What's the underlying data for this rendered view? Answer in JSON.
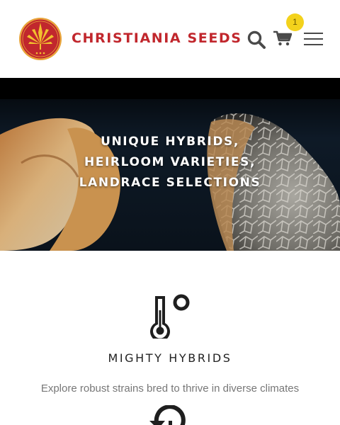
{
  "header": {
    "brand": "CHRISTIANIA SEEDS",
    "cart_count": "1",
    "logo_icon": "cannabis-leaf-icon",
    "icons": [
      "search-icon",
      "cart-icon",
      "hamburger-menu-icon"
    ]
  },
  "hero": {
    "lines": [
      "UNIQUE HYBRIDS,",
      "HEIRLOOM VARIETIES,",
      "LANDRACE SELECTIONS"
    ]
  },
  "feature": {
    "icon": "thermometer-icon",
    "title": "MIGHTY HYBRIDS",
    "description": "Explore robust strains bred to thrive in diverse climates",
    "next_icon": "history-icon"
  },
  "colors": {
    "brand_red": "#c1272d",
    "logo_gold": "#f2c12e",
    "badge_yellow": "#f3d21c",
    "text_dark": "#222222",
    "text_muted": "#777777"
  }
}
